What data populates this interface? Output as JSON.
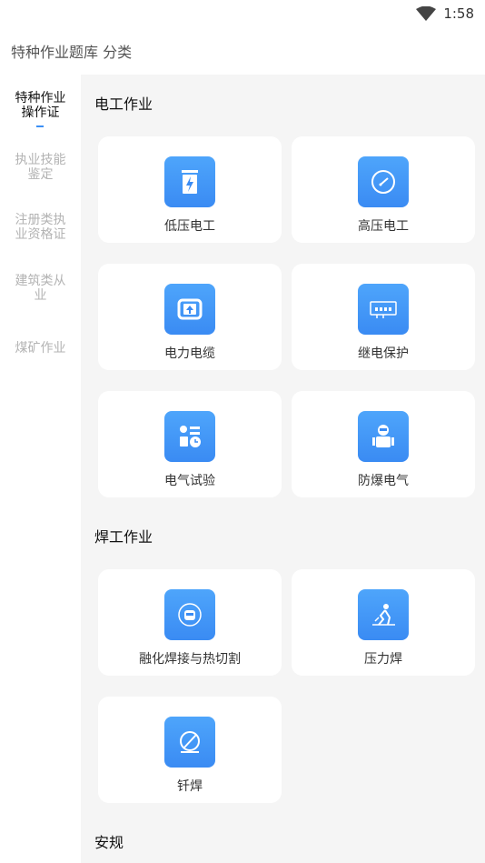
{
  "status_bar": {
    "time": "1:58",
    "wifi_icon": "wifi-icon"
  },
  "header": {
    "title": "特种作业题库 分类"
  },
  "sidebar": {
    "items": [
      {
        "label": "特种作业操作证",
        "active": true
      },
      {
        "label": "执业技能鉴定",
        "active": false
      },
      {
        "label": "注册类执业资格证",
        "active": false
      },
      {
        "label": "建筑类从业",
        "active": false
      },
      {
        "label": "煤矿作业",
        "active": false
      }
    ]
  },
  "sections": [
    {
      "title": "电工作业",
      "cards": [
        {
          "label": "低压电工",
          "icon": "low-voltage-icon"
        },
        {
          "label": "高压电工",
          "icon": "high-voltage-gauge-icon"
        },
        {
          "label": "电力电缆",
          "icon": "power-cable-icon"
        },
        {
          "label": "继电保护",
          "icon": "relay-protection-icon"
        },
        {
          "label": "电气试验",
          "icon": "electrical-test-icon"
        },
        {
          "label": "防爆电气",
          "icon": "explosion-proof-icon"
        }
      ]
    },
    {
      "title": "焊工作业",
      "cards": [
        {
          "label": "融化焊接与热切割",
          "icon": "fusion-welding-icon"
        },
        {
          "label": "压力焊",
          "icon": "pressure-welding-icon"
        },
        {
          "label": "钎焊",
          "icon": "brazing-icon"
        }
      ]
    },
    {
      "title": "安规",
      "cards": []
    }
  ],
  "colors": {
    "accent": "#3b8ff5",
    "tile_top": "#4ea5fb",
    "tile_bottom": "#3a8bf3"
  }
}
